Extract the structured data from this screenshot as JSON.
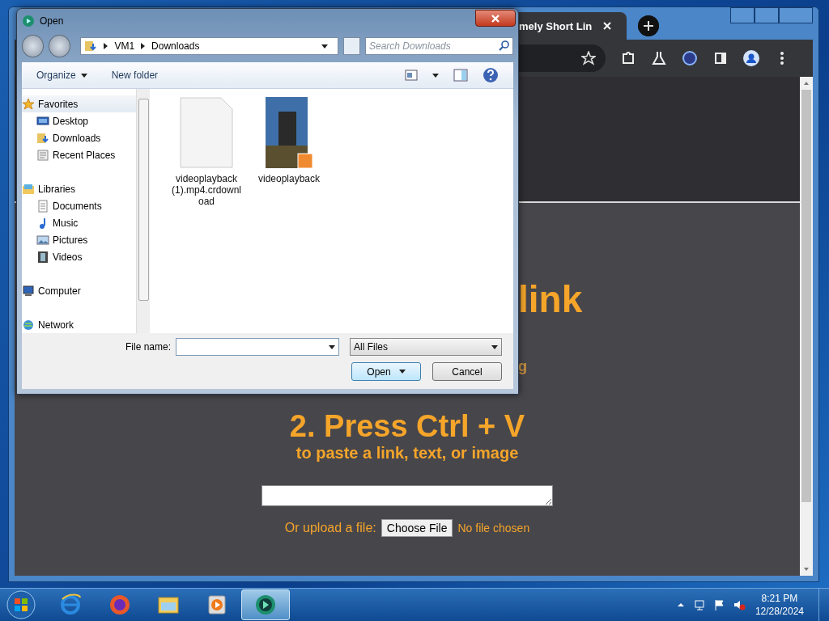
{
  "browser": {
    "tab_title": "mely Short Lin",
    "page": {
      "heading_fragment": "link",
      "line_fragment": "g",
      "step_title": "2. Press Ctrl + V",
      "step_subtitle": "to paste a link, text, or image",
      "upload_label": "Or upload a file:",
      "upload_button": "Choose File",
      "upload_status": "No file chosen"
    }
  },
  "dialog": {
    "title": "Open",
    "breadcrumbs": [
      "VM1",
      "Downloads"
    ],
    "search": {
      "placeholder": "Search Downloads"
    },
    "toolbar": [
      {
        "label": "Organize",
        "kind": "menu"
      },
      {
        "label": "New folder",
        "kind": "plain"
      }
    ],
    "nav": [
      {
        "label": "Favorites",
        "kind": "star",
        "selected": true,
        "children": [
          {
            "label": "Desktop",
            "kind": "desktop",
            "selected": false
          },
          {
            "label": "Downloads",
            "kind": "downloads",
            "selected": false
          },
          {
            "label": "Recent Places",
            "kind": "recent",
            "selected": false
          }
        ]
      },
      {
        "label": "Libraries",
        "kind": "library",
        "selected": false,
        "children": [
          {
            "label": "Documents",
            "kind": "documents",
            "selected": false
          },
          {
            "label": "Music",
            "kind": "music",
            "selected": false
          },
          {
            "label": "Pictures",
            "kind": "pictures",
            "selected": false
          },
          {
            "label": "Videos",
            "kind": "videos",
            "selected": false
          }
        ]
      },
      {
        "label": "Computer",
        "kind": "computer",
        "selected": false
      },
      {
        "label": "Network",
        "kind": "network",
        "selected": false
      }
    ],
    "files": [
      {
        "name": "videoplayback (1).mp4.crdownload",
        "kind": "blank"
      },
      {
        "name": "videoplayback",
        "kind": "video"
      }
    ],
    "file_name_label": "File name:",
    "file_type": "All Files",
    "buttons": [
      {
        "label": "Open",
        "kind": "split"
      },
      {
        "label": "Cancel",
        "kind": "plain"
      }
    ]
  },
  "taskbar": {
    "apps": [
      {
        "kind": "ie",
        "selected": false
      },
      {
        "kind": "firefox",
        "selected": false
      },
      {
        "kind": "explorer",
        "selected": false
      },
      {
        "kind": "media",
        "selected": false
      },
      {
        "kind": "chat",
        "selected": true
      }
    ],
    "time": "8:21 PM",
    "date": "12/28/2024"
  }
}
